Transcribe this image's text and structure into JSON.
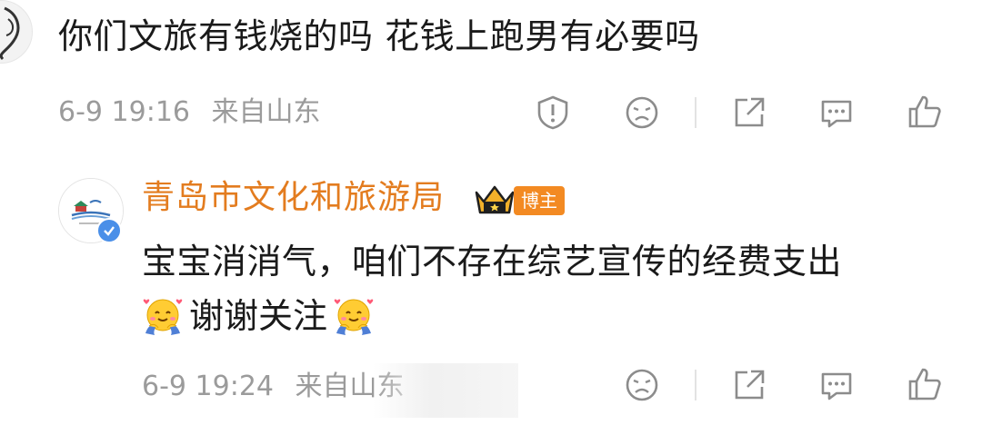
{
  "comment": {
    "text": "你们文旅有钱烧的吗 花钱上跑男有必要吗",
    "date": "6-9 19:16",
    "location": "来自山东",
    "actions": [
      "report-icon",
      "dislike-face-icon",
      "share-icon",
      "comment-icon",
      "like-icon"
    ]
  },
  "reply": {
    "author": "青岛市文化和旅游局",
    "role_badge": "博主",
    "text_line1": "宝宝消消气，咱们不存在综艺宣传的经费支出",
    "text_line2": "谢谢关注",
    "emoji": "hug-emoji",
    "date": "6-9 19:24",
    "location": "来自山东",
    "actions": [
      "dislike-face-icon",
      "share-icon",
      "comment-icon",
      "like-icon"
    ]
  },
  "colors": {
    "author_name": "#e37c1f",
    "badge_bg": "#f38a22",
    "meta_text": "#9b9b9b",
    "icon_gray": "#8c8c8c",
    "verified_blue": "#4a8fe8"
  }
}
